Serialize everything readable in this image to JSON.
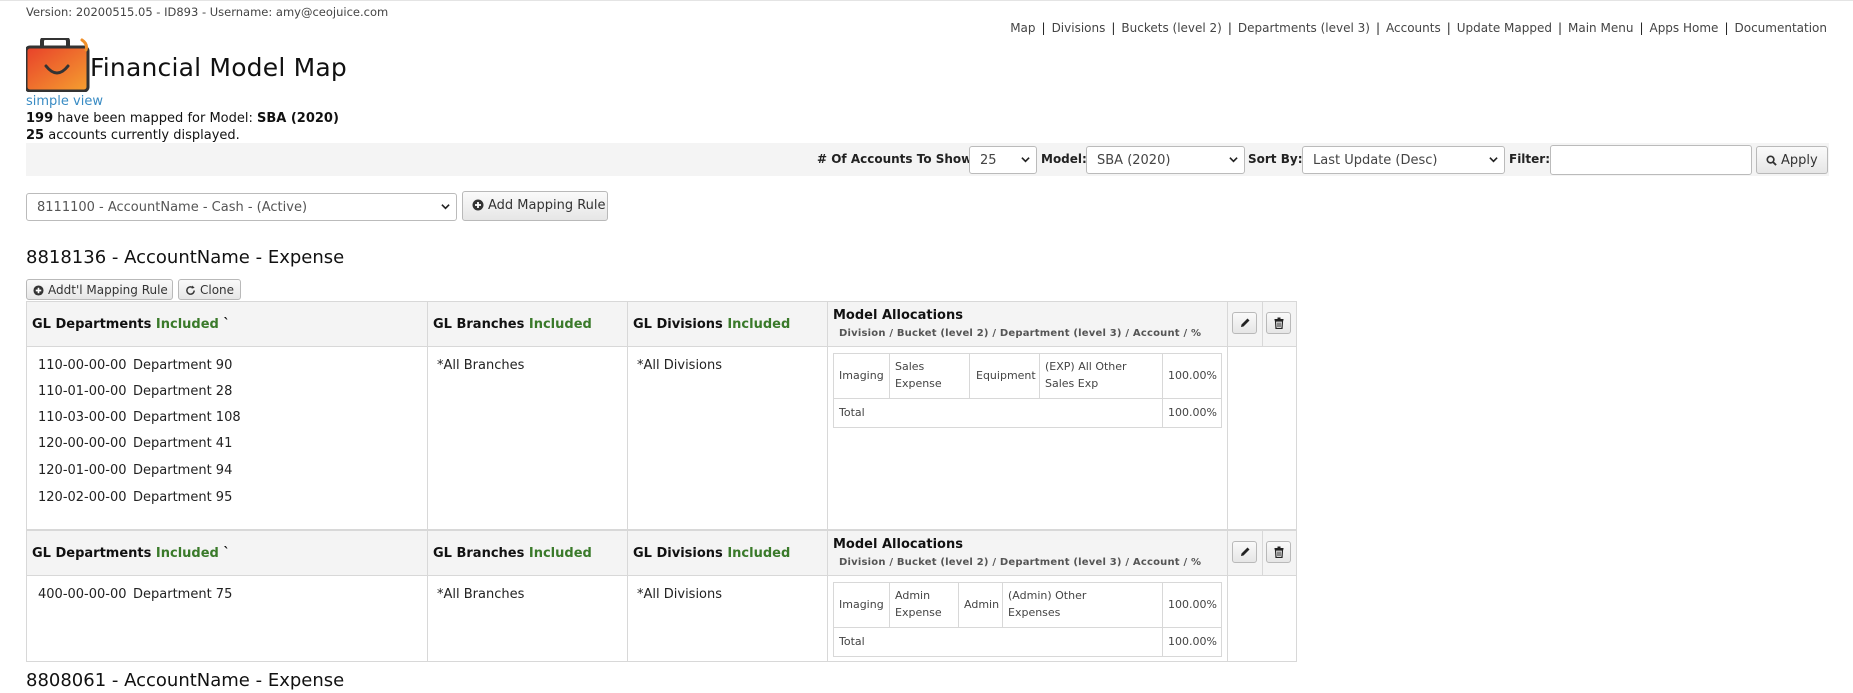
{
  "header": {
    "version": "Version: 20200515.05 - ID893 - Username: amy@ceojuice.com",
    "app_title": "Financial Model Map",
    "nav": [
      "Map",
      "Divisions",
      "Buckets (level 2)",
      "Departments (level 3)",
      "Accounts",
      "Update Mapped",
      "Main Menu",
      "Apps Home",
      "Documentation"
    ]
  },
  "summary": {
    "simple_view": "simple view",
    "mapped_count": "199",
    "mapped_text": " have been mapped for Model: ",
    "model_name": "SBA (2020)",
    "displayed_count": "25",
    "displayed_text": " accounts currently displayed."
  },
  "filters": {
    "accounts_label": "# Of Accounts To Show:",
    "accounts_value": "25",
    "model_label": "Model:",
    "model_value": "SBA (2020)",
    "sort_label": "Sort By:",
    "sort_value": "Last Update (Desc)",
    "filter_label": "Filter:",
    "filter_value": "",
    "apply_label": "Apply"
  },
  "add_rule": {
    "account_select": "8111100 - AccountName - Cash - (Active)",
    "button_label": "Add Mapping Rule"
  },
  "accounts": [
    {
      "heading": "8818136 - AccountName - Expense",
      "addtl_label": "Addt'l Mapping Rule",
      "clone_label": "Clone",
      "columns": {
        "departments": "GL Departments",
        "branches": "GL Branches",
        "divisions": "GL Divisions",
        "included": "Included",
        "tick": "`",
        "allocations": "Model Allocations",
        "allocations_sub": "Division / Bucket (level 2) / Department (level 3) / Account / %"
      },
      "rules": [
        {
          "departments": [
            {
              "code": "110-00-00-00",
              "name": "Department 90"
            },
            {
              "code": "110-01-00-00",
              "name": "Department 28"
            },
            {
              "code": "110-03-00-00",
              "name": "Department 108"
            },
            {
              "code": "120-00-00-00",
              "name": "Department 41"
            },
            {
              "code": "120-01-00-00",
              "name": "Department 94"
            },
            {
              "code": "120-02-00-00",
              "name": "Department 95"
            }
          ],
          "branches": "*All Branches",
          "divisions": "*All Divisions",
          "allocation": {
            "division": "Imaging",
            "bucket_line1": "Sales",
            "bucket_line2": "Expense",
            "department": "Equipment",
            "account_line1": "(EXP) All Other",
            "account_line2": "Sales Exp",
            "percent": "100.00%",
            "total_label": "Total",
            "total_percent": "100.00%"
          }
        },
        {
          "departments": [
            {
              "code": "400-00-00-00",
              "name": "Department 75"
            }
          ],
          "branches": "*All Branches",
          "divisions": "*All Divisions",
          "allocation": {
            "division": "Imaging",
            "bucket_line1": "Admin",
            "bucket_line2": "Expense",
            "department": "Admin",
            "account_line1": "(Admin) Other",
            "account_line2": "Expenses",
            "percent": "100.00%",
            "total_label": "Total",
            "total_percent": "100.00%"
          }
        }
      ]
    },
    {
      "heading": "8808061 - AccountName - Expense"
    }
  ],
  "icons": {
    "logo": "briefcase-smile-logo",
    "add": "plus-circle-icon",
    "clone": "refresh-icon",
    "search": "search-icon",
    "edit": "pencil-icon",
    "delete": "trash-icon"
  },
  "colors": {
    "included_green": "#3a7a2a",
    "link_blue": "#3a8cc4",
    "logo_orange": "#f0902a",
    "logo_red": "#e8402a"
  }
}
